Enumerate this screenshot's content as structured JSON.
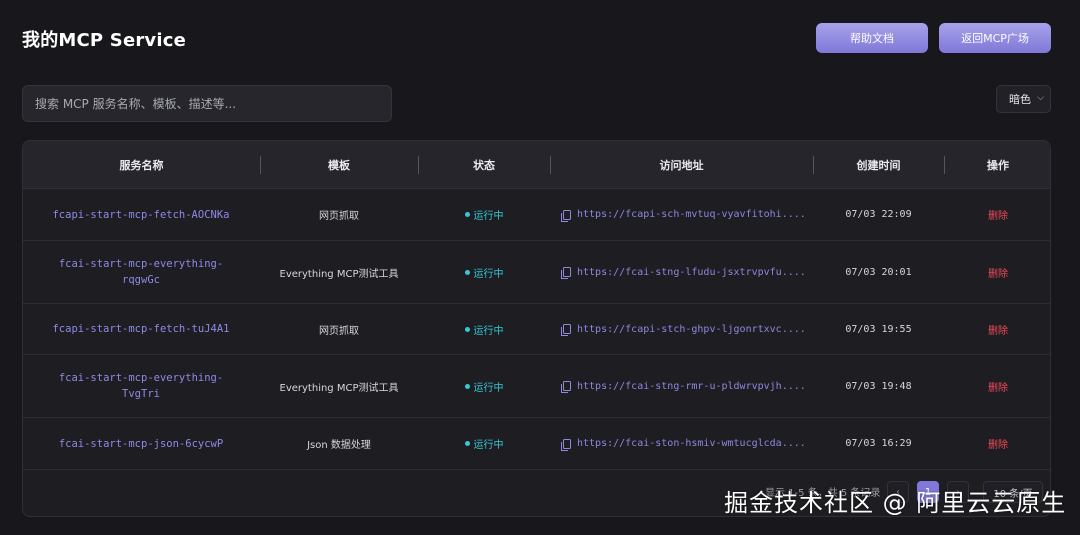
{
  "header": {
    "title": "我的MCP Service",
    "help_label": "帮助文档",
    "back_label": "返回MCP广场"
  },
  "search": {
    "placeholder": "搜索 MCP 服务名称、模板、描述等..."
  },
  "theme": {
    "selected": "暗色"
  },
  "table": {
    "columns": [
      "服务名称",
      "模板",
      "状态",
      "访问地址",
      "创建时间",
      "操作"
    ],
    "rows": [
      {
        "name": "fcapi-start-mcp-fetch-AOCNKa",
        "template": "网页抓取",
        "status": "运行中",
        "url": "https://fcapi-sch-mvtuq-vyavfitohi....",
        "created": "07/03 22:09",
        "action": "删除"
      },
      {
        "name": "fcai-start-mcp-everything-rqgwGc",
        "template": "Everything MCP测试工具",
        "status": "运行中",
        "url": "https://fcai-stng-lfudu-jsxtrvpvfu....",
        "created": "07/03 20:01",
        "action": "删除"
      },
      {
        "name": "fcapi-start-mcp-fetch-tuJ4A1",
        "template": "网页抓取",
        "status": "运行中",
        "url": "https://fcapi-stch-ghpv-ljgonrtxvc....",
        "created": "07/03 19:55",
        "action": "删除"
      },
      {
        "name": "fcai-start-mcp-everything-TvgTri",
        "template": "Everything MCP测试工具",
        "status": "运行中",
        "url": "https://fcai-stng-rmr-u-pldwrvpvjh....",
        "created": "07/03 19:48",
        "action": "删除"
      },
      {
        "name": "fcai-start-mcp-json-6cycwP",
        "template": "Json 数据处理",
        "status": "运行中",
        "url": "https://fcai-ston-hsmiv-wmtucglcda....",
        "created": "07/03 16:29",
        "action": "删除"
      }
    ]
  },
  "pagination": {
    "summary": "显示 1-5 条，共 5 条记录",
    "prev": "‹",
    "current": "1",
    "next": "›",
    "page_size": "10 条/页"
  },
  "watermark": "掘金技术社区 @ 阿里云云原生",
  "colors": {
    "accent": "#8f89e6",
    "status_running": "#36c8d8",
    "danger": "#ef4a5a",
    "background": "#17171c"
  }
}
